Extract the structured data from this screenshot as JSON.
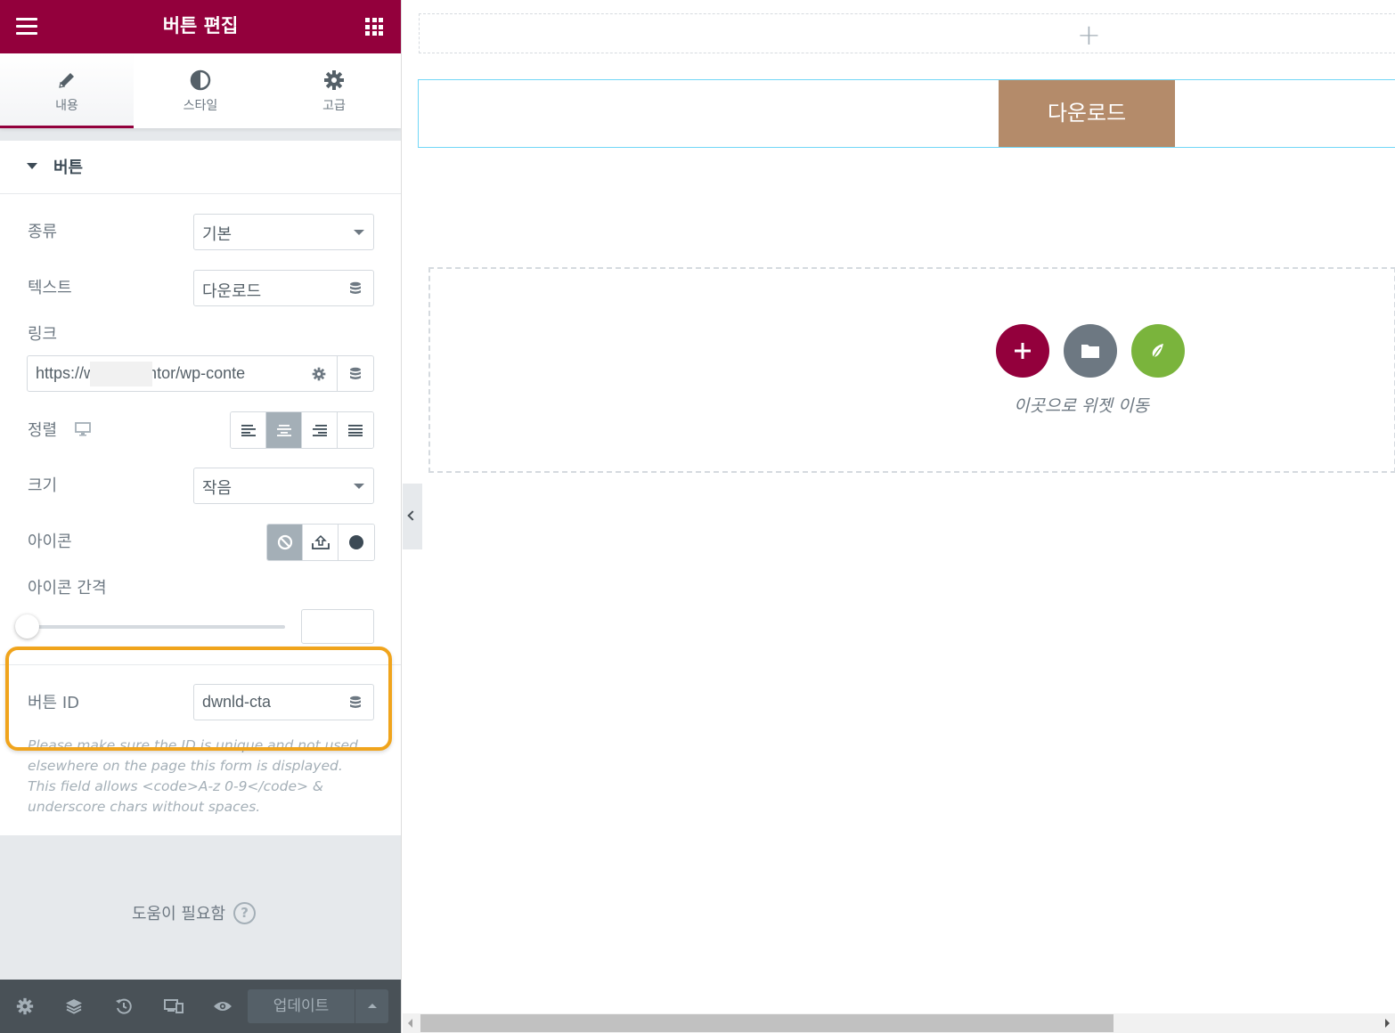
{
  "header": {
    "title": "버튼 편집"
  },
  "tabs": [
    {
      "label": "내용",
      "icon": "pencil-icon",
      "active": true
    },
    {
      "label": "스타일",
      "icon": "contrast-icon",
      "active": false
    },
    {
      "label": "고급",
      "icon": "gear-icon",
      "active": false
    }
  ],
  "section": {
    "title": "버튼"
  },
  "controls": {
    "type": {
      "label": "종류",
      "value": "기본"
    },
    "text": {
      "label": "텍스트",
      "value": "다운로드"
    },
    "link": {
      "label": "링크",
      "value": "https://w          /elementor/wp-conte"
    },
    "align": {
      "label": "정렬",
      "selected": "center"
    },
    "size": {
      "label": "크기",
      "value": "작음"
    },
    "icon": {
      "label": "아이콘",
      "selected": "none"
    },
    "icon_spacing": {
      "label": "아이콘 간격",
      "value": 0
    },
    "button_id": {
      "label": "버튼 ID",
      "value": "dwnld-cta",
      "help": "Please make sure the ID is unique and not used elsewhere on the page this form is displayed. This field allows <code>A-z 0-9</code> & underscore chars without spaces."
    }
  },
  "help": {
    "label": "도움이 필요함"
  },
  "footer": {
    "update_label": "업데이트"
  },
  "canvas": {
    "cta_label": "다운로드",
    "drop_text": "이곳으로 위젯 이동"
  },
  "colors": {
    "brand": "#93003c",
    "cta": "#b48b6a",
    "add_green": "#7ab43c",
    "highlight": "#f0a41c"
  }
}
